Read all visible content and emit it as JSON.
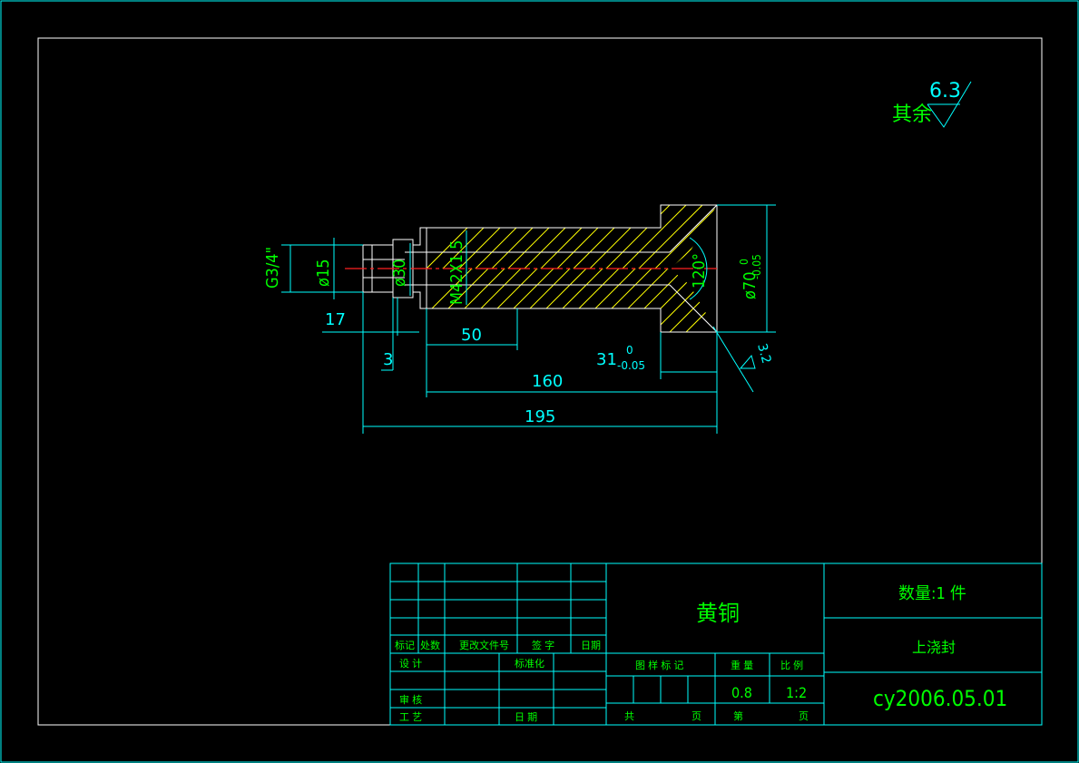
{
  "surface_finish": {
    "prefix": "其余",
    "value": "6.3"
  },
  "surface_finish_local": {
    "value": "3.2"
  },
  "dimensions": {
    "thread_g": "G3/4\"",
    "dia15": "ø15",
    "dia30": "ø30",
    "thread_m": "M42X1.5",
    "angle": "120°",
    "dia70": "ø70",
    "dia70_tol_upper": "0",
    "dia70_tol_lower": "-0.05",
    "len17": "17",
    "len3": "3",
    "len50": "50",
    "len31": "31",
    "len31_tol_upper": "0",
    "len31_tol_lower": "-0.05",
    "len160": "160",
    "len195": "195"
  },
  "title_block": {
    "material": "黄铜",
    "quantity": "数量:1  件",
    "part_name": "上浇封",
    "drawing_no": "cy2006.05.01",
    "h_mark": "标记",
    "h_count": "处数",
    "h_doc": "更改文件号",
    "h_sign": "签 字",
    "h_date": "日期",
    "h_design": "设 计",
    "h_std": "标准化",
    "h_check": "审 核",
    "h_process": "工 艺",
    "h_date2": "日 期",
    "h_stage": "图 样 标 记",
    "h_weight": "重 量",
    "h_scale": "比 例",
    "weight": "0.8",
    "scale": "1:2",
    "h_total": "共",
    "h_sheet": "页",
    "h_no": "第",
    "h_page": "页"
  }
}
